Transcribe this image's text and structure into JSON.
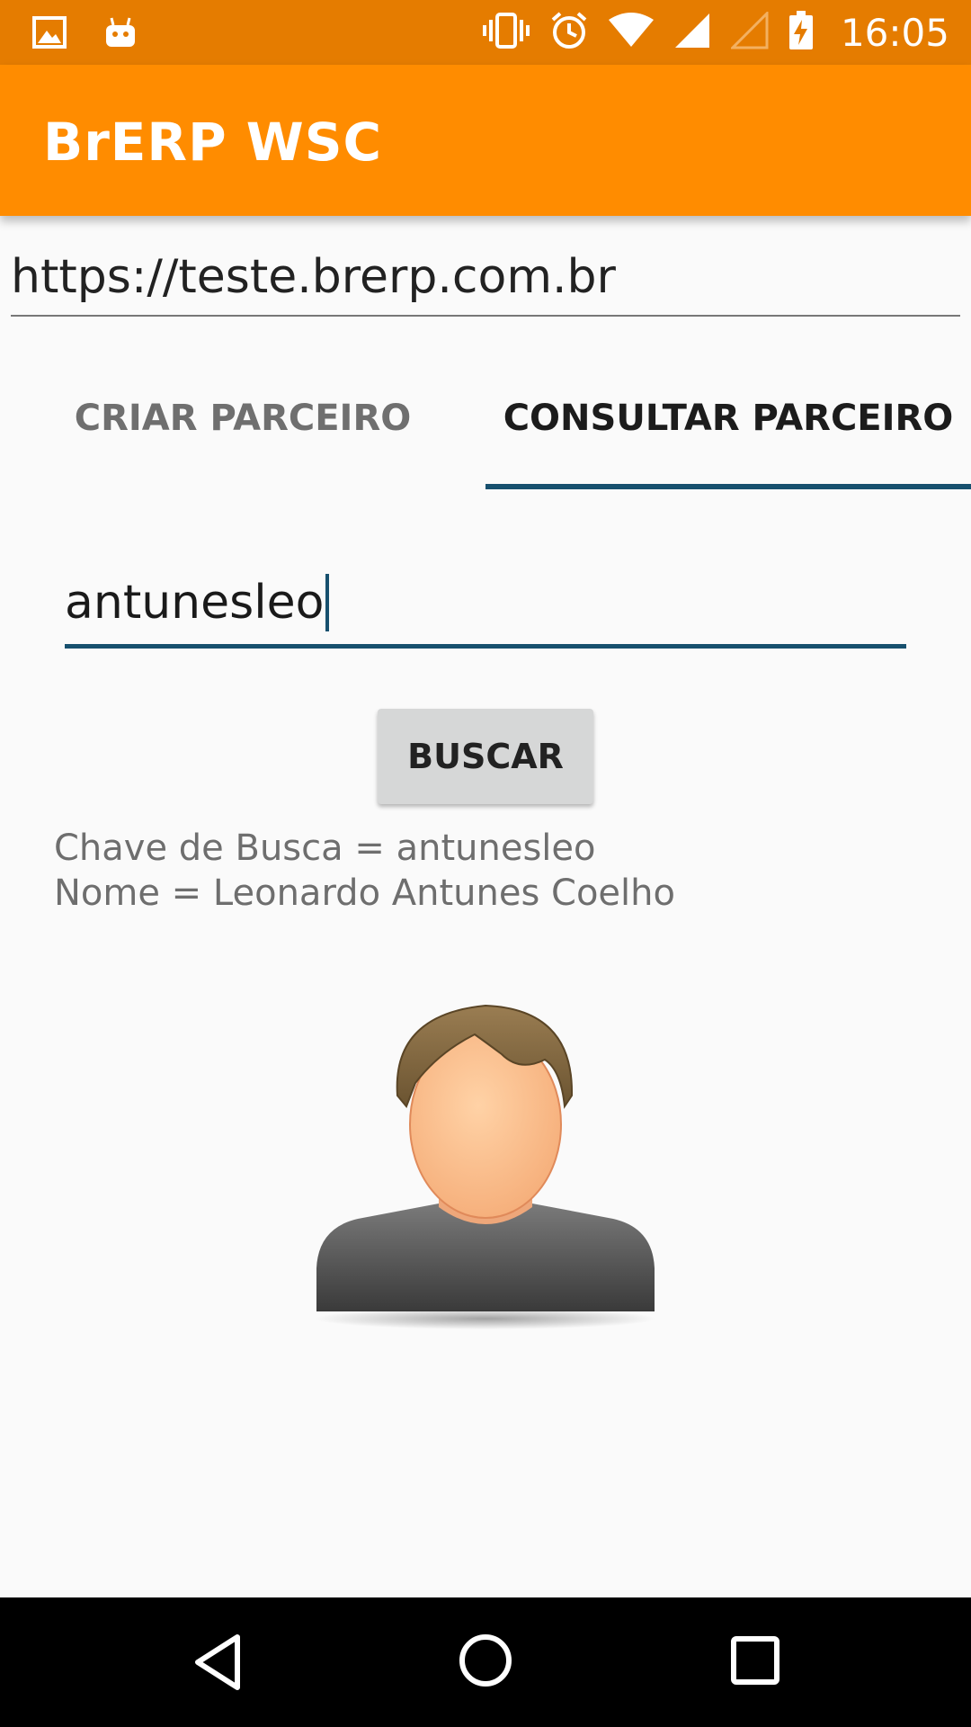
{
  "status_bar": {
    "time": "16:05",
    "icons": [
      "gallery-icon",
      "android-icon",
      "vibrate-icon",
      "alarm-icon",
      "wifi-icon",
      "signal-icon",
      "no-signal-icon",
      "battery-charging-icon"
    ],
    "color": "#e57c00"
  },
  "app_bar": {
    "title": "BrERP WSC",
    "color": "#ff8c00"
  },
  "server_url": {
    "value": "https://teste.brerp.com.br"
  },
  "tabs": [
    {
      "label": "CRIAR PARCEIRO",
      "selected": false
    },
    {
      "label": "CONSULTAR PARCEIRO",
      "selected": true
    }
  ],
  "search": {
    "value": "antunesleo",
    "button_label": "BUSCAR"
  },
  "result": {
    "line1": "Chave de Busca = antunesleo",
    "line2": "Nome = Leonardo Antunes Coelho",
    "avatar_icon": "user-avatar-icon"
  },
  "nav_bar": {
    "icons": [
      "back-icon",
      "home-icon",
      "recents-icon"
    ]
  },
  "colors": {
    "accent": "#17506e",
    "background": "#fafafa"
  }
}
